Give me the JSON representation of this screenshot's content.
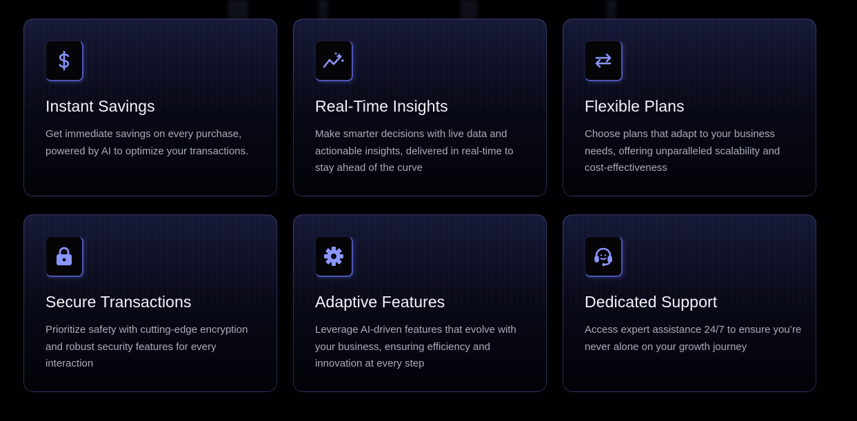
{
  "theme": {
    "accent": "#8b96ff",
    "background": "#010103"
  },
  "features": [
    {
      "icon": "dollar-icon",
      "title": "Instant Savings",
      "description": "Get immediate savings on every purchase, powered by AI to optimize your transactions."
    },
    {
      "icon": "sparkle-trend-icon",
      "title": "Real-Time Insights",
      "description": "Make smarter decisions with live data and actionable insights, delivered in real-time to stay ahead of the curve"
    },
    {
      "icon": "swap-arrows-icon",
      "title": "Flexible Plans",
      "description": "Choose plans that adapt to your business needs, offering unparalleled scalability and cost-effectiveness"
    },
    {
      "icon": "lock-icon",
      "title": "Secure Transactions",
      "description": "Prioritize safety with cutting-edge encryption and robust security features for every interaction"
    },
    {
      "icon": "gear-icon",
      "title": "Adaptive Features",
      "description": "Leverage AI-driven features that evolve with your business, ensuring efficiency and innovation at every step"
    },
    {
      "icon": "headset-icon",
      "title": "Dedicated Support",
      "description": "Access expert assistance 24/7 to ensure you’re never alone on your growth journey"
    }
  ]
}
